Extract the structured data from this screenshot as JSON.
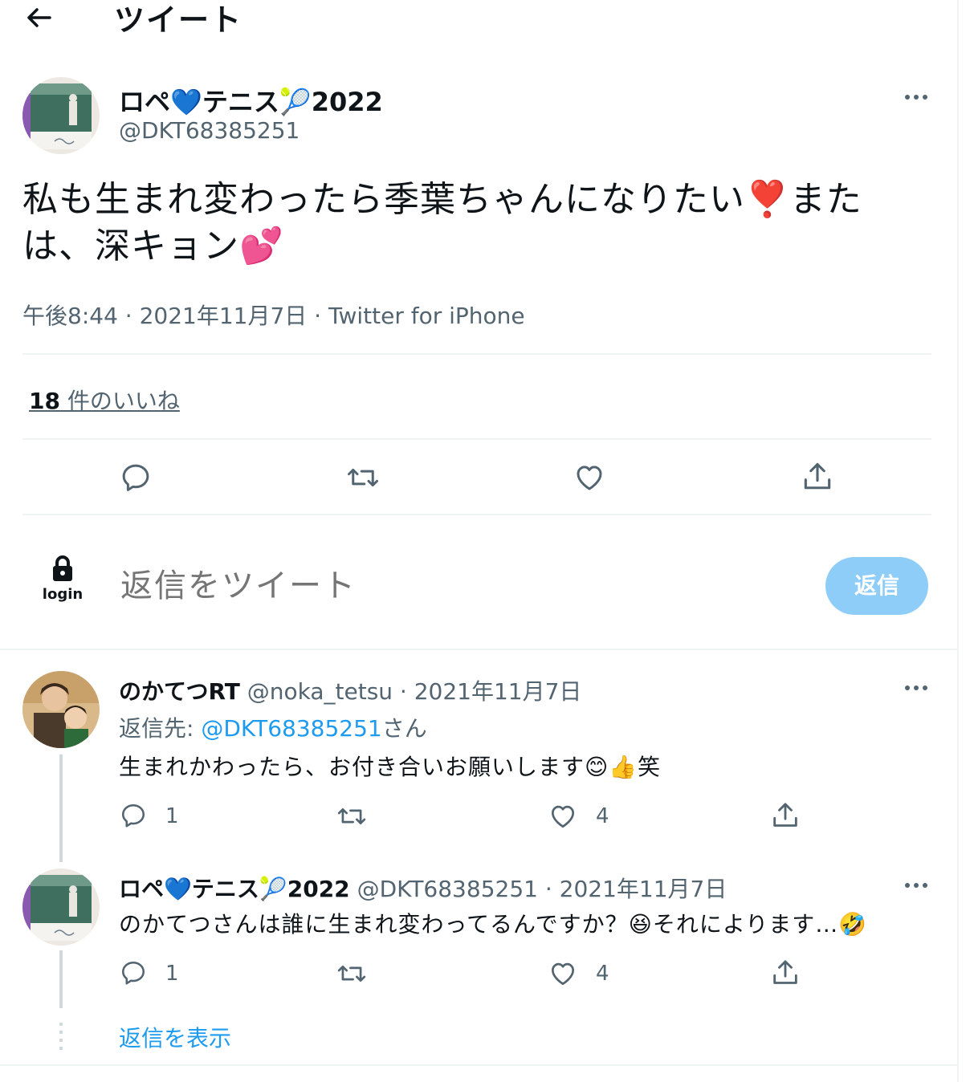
{
  "header": {
    "title": "ツイート",
    "back_icon": "arrow-left-icon"
  },
  "main_tweet": {
    "author": {
      "name_part1": "ロペ",
      "heart_emoji": "💙",
      "name_part2": "テニス",
      "ball_emoji": "🎾",
      "name_part3": "2022",
      "handle": "@DKT68385251"
    },
    "text_line1": "私も生まれ変わったら季葉ちゃんになりたい❣️また",
    "text_line2": "は、深キョン💕",
    "meta": "午後8:44 · 2021年11月7日 · Twitter for iPhone",
    "likes_count": "18",
    "likes_label": " 件のいいね"
  },
  "compose": {
    "login_label": "login",
    "placeholder": "返信をツイート",
    "reply_button": "返信"
  },
  "replies": [
    {
      "name": "のかてつRT",
      "handle": "@noka_tetsu",
      "date": " · 2021年11月7日",
      "replying_to_label": "返信先: ",
      "replying_to_handle": "@DKT68385251",
      "replying_to_suffix": "さん",
      "text": "生まれかわったら、お付き合いお願いします😊👍笑",
      "reply_count": "1",
      "like_count": "4"
    },
    {
      "name": "ロペ💙テニス🎾2022",
      "handle": "@DKT68385251",
      "date": " · 2021年11月7日",
      "text": "のかてつさんは誰に生まれ変わってるんですか？😆それによります…🤣",
      "reply_count": "1",
      "like_count": "4"
    }
  ],
  "show_replies": "返信を表示",
  "colors": {
    "accent": "#1d9bf0",
    "button_disabled": "#8ecdf8",
    "text_secondary": "#536471",
    "divider": "#eff3f4"
  }
}
